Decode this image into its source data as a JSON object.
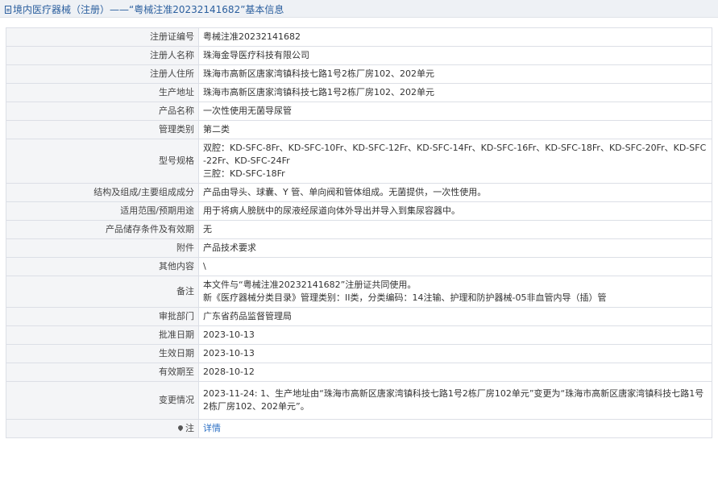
{
  "header": {
    "title": "境内医疗器械（注册）——“粤械注准20232141682”基本信息"
  },
  "rows": [
    {
      "label": "注册证编号",
      "lines": [
        "粤械注准20232141682"
      ]
    },
    {
      "label": "注册人名称",
      "lines": [
        "珠海金导医疗科技有限公司"
      ]
    },
    {
      "label": "注册人住所",
      "lines": [
        "珠海市高新区唐家湾镇科技七路1号2栋厂房102、202单元"
      ]
    },
    {
      "label": "生产地址",
      "lines": [
        "珠海市高新区唐家湾镇科技七路1号2栋厂房102、202单元"
      ]
    },
    {
      "label": "产品名称",
      "lines": [
        "一次性使用无菌导尿管"
      ]
    },
    {
      "label": "管理类别",
      "lines": [
        "第二类"
      ]
    },
    {
      "label": "型号规格",
      "lines": [
        "双腔：KD-SFC-8Fr、KD-SFC-10Fr、KD-SFC-12Fr、KD-SFC-14Fr、KD-SFC-16Fr、KD-SFC-18Fr、KD-SFC-20Fr、KD-SFC-22Fr、KD-SFC-24Fr",
        "三腔：KD-SFC-18Fr"
      ]
    },
    {
      "label": "结构及组成/主要组成成分",
      "lines": [
        "产品由导头、球囊、Y 管、单向阀和管体组成。无菌提供，一次性使用。"
      ]
    },
    {
      "label": "适用范围/预期用途",
      "lines": [
        "用于将病人膀胱中的尿液经尿道向体外导出并导入到集尿容器中。"
      ]
    },
    {
      "label": "产品储存条件及有效期",
      "lines": [
        "无"
      ]
    },
    {
      "label": "附件",
      "lines": [
        "产品技术要求"
      ]
    },
    {
      "label": "其他内容",
      "lines": [
        "\\"
      ]
    },
    {
      "label": "备注",
      "lines": [
        "本文件与“粤械注准20232141682”注册证共同使用。",
        "新《医疗器械分类目录》管理类别：II类，分类编码：14注输、护理和防护器械-05非血管内导（插）管"
      ]
    },
    {
      "label": "审批部门",
      "lines": [
        "广东省药品监督管理局"
      ]
    },
    {
      "label": "批准日期",
      "lines": [
        "2023-10-13"
      ]
    },
    {
      "label": "生效日期",
      "lines": [
        "2023-10-13"
      ]
    },
    {
      "label": "有效期至",
      "lines": [
        "2028-10-12"
      ]
    },
    {
      "label": "变更情况",
      "lines": [
        "2023-11-24: 1、生产地址由“珠海市高新区唐家湾镇科技七路1号2栋厂房102单元”变更为“珠海市高新区唐家湾镇科技七路1号2栋厂房102、202单元”。"
      ]
    }
  ],
  "note": {
    "label": "注",
    "link_text": "详情"
  }
}
